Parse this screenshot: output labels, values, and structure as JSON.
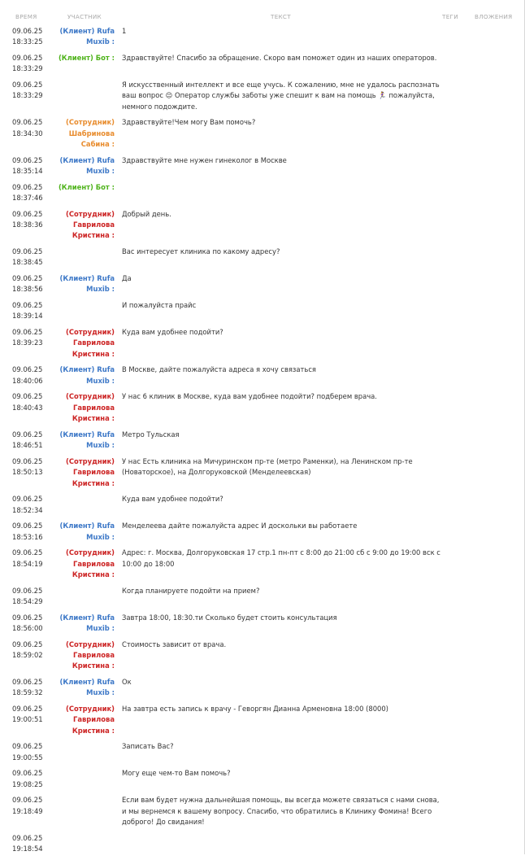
{
  "columns": {
    "time": "ВРЕМЯ",
    "participant": "УЧАСТНИК",
    "text": "ТЕКСТ",
    "tags": "ТЕГИ",
    "attachments": "ВЛОЖЕНИЯ"
  },
  "role_colors": {
    "client": "#3d78c7",
    "bot": "#4fb31b",
    "staff": "#cc2424",
    "staff_sabina": "#e88c2e"
  },
  "messages": [
    {
      "date": "09.06.25",
      "time": "18:33:25",
      "role": "client",
      "role_label": "(Клиент)",
      "name": "Rufa Muxib",
      "text": "1"
    },
    {
      "date": "09.06.25",
      "time": "18:33:29",
      "role": "bot",
      "role_label": "(Клиент)",
      "name": "Бот",
      "text": "Здравствуйте! Спасибо за обращение. Скоро вам поможет один из наших операторов."
    },
    {
      "date": "09.06.25",
      "time": "18:33:29",
      "role": "",
      "role_label": "",
      "name": "",
      "text": "Я искусственный интеллект и все еще учусь. К сожалению, мне не удалось распознать ваш вопрос 😔 Оператор службы заботы уже спешит к вам на помощь 🏃‍♀️ пожалуйста, немного подождите."
    },
    {
      "date": "09.06.25",
      "time": "18:34:30",
      "role": "staff2",
      "role_label": "(Сотрудник)",
      "name": "Шабринова Сабина",
      "text": "Здравствуйте!Чем могу Вам помочь?"
    },
    {
      "date": "09.06.25",
      "time": "18:35:14",
      "role": "client",
      "role_label": "(Клиент)",
      "name": "Rufa Muxib",
      "text": "Здравствуйте мне нужен гинеколог в Москве"
    },
    {
      "date": "09.06.25",
      "time": "18:37:46",
      "role": "bot",
      "role_label": "(Клиент)",
      "name": "Бот",
      "text": ""
    },
    {
      "date": "09.06.25",
      "time": "18:38:36",
      "role": "staff",
      "role_label": "(Сотрудник)",
      "name": "Гаврилова Кристина",
      "text": "Добрый день."
    },
    {
      "date": "09.06.25",
      "time": "18:38:45",
      "role": "",
      "role_label": "",
      "name": "",
      "text": "Вас интересует клиника по какому адресу?"
    },
    {
      "date": "09.06.25",
      "time": "18:38:56",
      "role": "client",
      "role_label": "(Клиент)",
      "name": "Rufa Muxib",
      "text": "Да"
    },
    {
      "date": "09.06.25",
      "time": "18:39:14",
      "role": "",
      "role_label": "",
      "name": "",
      "text": "И пожалуйста прайс"
    },
    {
      "date": "09.06.25",
      "time": "18:39:23",
      "role": "staff",
      "role_label": "(Сотрудник)",
      "name": "Гаврилова Кристина",
      "text": "Куда вам удобнее подойти?"
    },
    {
      "date": "09.06.25",
      "time": "18:40:06",
      "role": "client",
      "role_label": "(Клиент)",
      "name": "Rufa Muxib",
      "text": "В Москве, дайте пожалуйста адреса я хочу связаться"
    },
    {
      "date": "09.06.25",
      "time": "18:40:43",
      "role": "staff",
      "role_label": "(Сотрудник)",
      "name": "Гаврилова Кристина",
      "text": "У нас 6 клиник в Москве, куда вам удобнее подойти? подберем врача."
    },
    {
      "date": "09.06.25",
      "time": "18:46:51",
      "role": "client",
      "role_label": "(Клиент)",
      "name": "Rufa Muxib",
      "text": "Метро Тульская"
    },
    {
      "date": "09.06.25",
      "time": "18:50:13",
      "role": "staff",
      "role_label": "(Сотрудник)",
      "name": "Гаврилова Кристина",
      "text": "У нас Есть клиника на Мичуринском пр-те (метро Раменки), на Ленинском пр-те (Новаторское), на Долгоруковской (Менделеевская)"
    },
    {
      "date": "09.06.25",
      "time": "18:52:34",
      "role": "",
      "role_label": "",
      "name": "",
      "text": "Куда вам удобнее подойти?"
    },
    {
      "date": "09.06.25",
      "time": "18:53:16",
      "role": "client",
      "role_label": "(Клиент)",
      "name": "Rufa Muxib",
      "text": "Менделеева дайте пожалуйста адрес И доскольки вы работаете"
    },
    {
      "date": "09.06.25",
      "time": "18:54:19",
      "role": "staff",
      "role_label": "(Сотрудник)",
      "name": "Гаврилова Кристина",
      "text": "Адрес: г. Москва, Долгоруковская 17 стр.1 пн-пт с 8:00 до 21:00 сб с 9:00 до 19:00 вск с 10:00 до 18:00"
    },
    {
      "date": "09.06.25",
      "time": "18:54:29",
      "role": "",
      "role_label": "",
      "name": "",
      "text": "Когда планируете подойти на прием?"
    },
    {
      "date": "09.06.25",
      "time": "18:56:00",
      "role": "client",
      "role_label": "(Клиент)",
      "name": "Rufa Muxib",
      "text": "Завтра 18:00, 18:30.ти Сколько будет стоить консультация"
    },
    {
      "date": "09.06.25",
      "time": "18:59:02",
      "role": "staff",
      "role_label": "(Сотрудник)",
      "name": "Гаврилова Кристина",
      "text": "Стоимость зависит от врача."
    },
    {
      "date": "09.06.25",
      "time": "18:59:32",
      "role": "client",
      "role_label": "(Клиент)",
      "name": "Rufa Muxib",
      "text": "Ок"
    },
    {
      "date": "09.06.25",
      "time": "19:00:51",
      "role": "staff",
      "role_label": "(Сотрудник)",
      "name": "Гаврилова Кристина",
      "text": "На завтра есть запись к врачу - Геворгян Дианна Армeновна 18:00 (8000)"
    },
    {
      "date": "09.06.25",
      "time": "19:00:55",
      "role": "",
      "role_label": "",
      "name": "",
      "text": "Записать Вас?"
    },
    {
      "date": "09.06.25",
      "time": "19:08:25",
      "role": "",
      "role_label": "",
      "name": "",
      "text": "Могу еще чем-то Вам помочь?"
    },
    {
      "date": "09.06.25",
      "time": "19:18:49",
      "role": "",
      "role_label": "",
      "name": "",
      "text": "Если вам будет нужна дальнейшая помощь, вы всегда можете связаться с нами снова, и мы вернемся к вашему вопросу. Спасибо, что обратились в Клинику Фомина! Всего доброго! До свидания!"
    },
    {
      "date": "09.06.25",
      "time": "19:18:54",
      "role": "",
      "role_label": "",
      "name": "",
      "text": ""
    }
  ]
}
